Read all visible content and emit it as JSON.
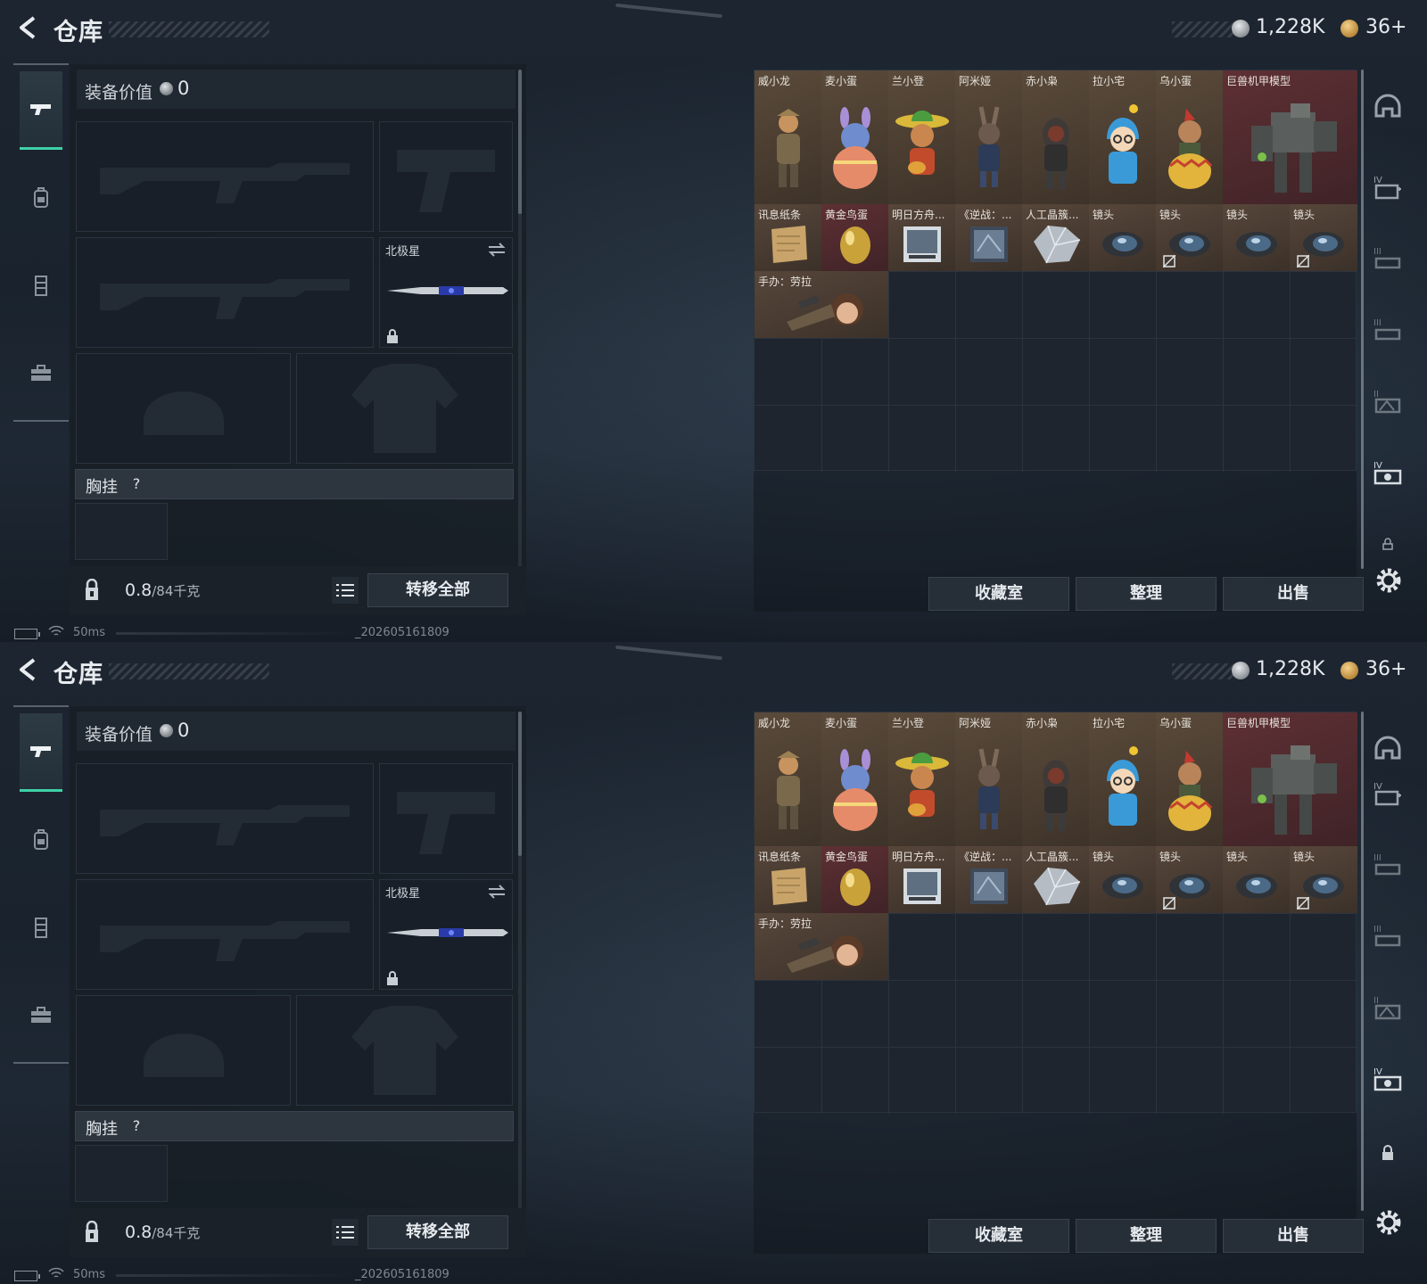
{
  "screens": [
    {
      "title": "仓库",
      "currency": {
        "silver": "1,228K",
        "gold": "36+"
      },
      "equipment": {
        "value_label": "装备价值",
        "value": "0",
        "knife_name": "北极星",
        "chest_label": "胸挂",
        "help": "?",
        "weight": "0.8",
        "weight_max": "/84千克",
        "transfer_all": "转移全部"
      },
      "inventory": {
        "items": [
          "威小龙",
          "麦小蛋",
          "兰小登",
          "阿米娅",
          "赤小枭",
          "拉小宅",
          "乌小蛋",
          "巨兽机甲模型",
          "讯息纸条",
          "黄金鸟蛋",
          "明日方舟...",
          "《逆战：...",
          "人工晶簇...",
          "镜头",
          "镜头",
          "镜头",
          "镜头",
          "手办：劳拉"
        ],
        "actions": [
          "收藏室",
          "整理",
          "出售"
        ]
      },
      "status": {
        "ping": "50ms",
        "build": "_202605161809"
      }
    },
    {
      "title": "仓库",
      "currency": {
        "silver": "1,228K",
        "gold": "36+"
      },
      "equipment": {
        "value_label": "装备价值",
        "value": "0",
        "knife_name": "北极星",
        "chest_label": "胸挂",
        "help": "?",
        "weight": "0.8",
        "weight_max": "/84千克",
        "transfer_all": "转移全部"
      },
      "inventory": {
        "items": [
          "威小龙",
          "麦小蛋",
          "兰小登",
          "阿米娅",
          "赤小枭",
          "拉小宅",
          "乌小蛋",
          "巨兽机甲模型",
          "讯息纸条",
          "黄金鸟蛋",
          "明日方舟...",
          "《逆战：...",
          "人工晶簇...",
          "镜头",
          "镜头",
          "镜头",
          "镜头",
          "手办：劳拉"
        ],
        "actions": [
          "收藏室",
          "整理",
          "出售"
        ]
      },
      "status": {
        "ping": "50ms",
        "build": "_202605161809"
      }
    }
  ],
  "colors": {
    "accent": "#3fd1a7",
    "gold_cell": "#5a4a3a",
    "red_cell": "#5e3034"
  },
  "icons": {
    "left_nav": [
      "pistol-icon",
      "backpack-icon",
      "vest-icon",
      "toolbox-icon"
    ],
    "right_nav": [
      "helmet-icon",
      "tag-iv-icon",
      "tag-iii-icon",
      "tag-iii-icon",
      "tag-ii-icon",
      "tag-iv-camera-icon",
      "lock-icon"
    ]
  }
}
